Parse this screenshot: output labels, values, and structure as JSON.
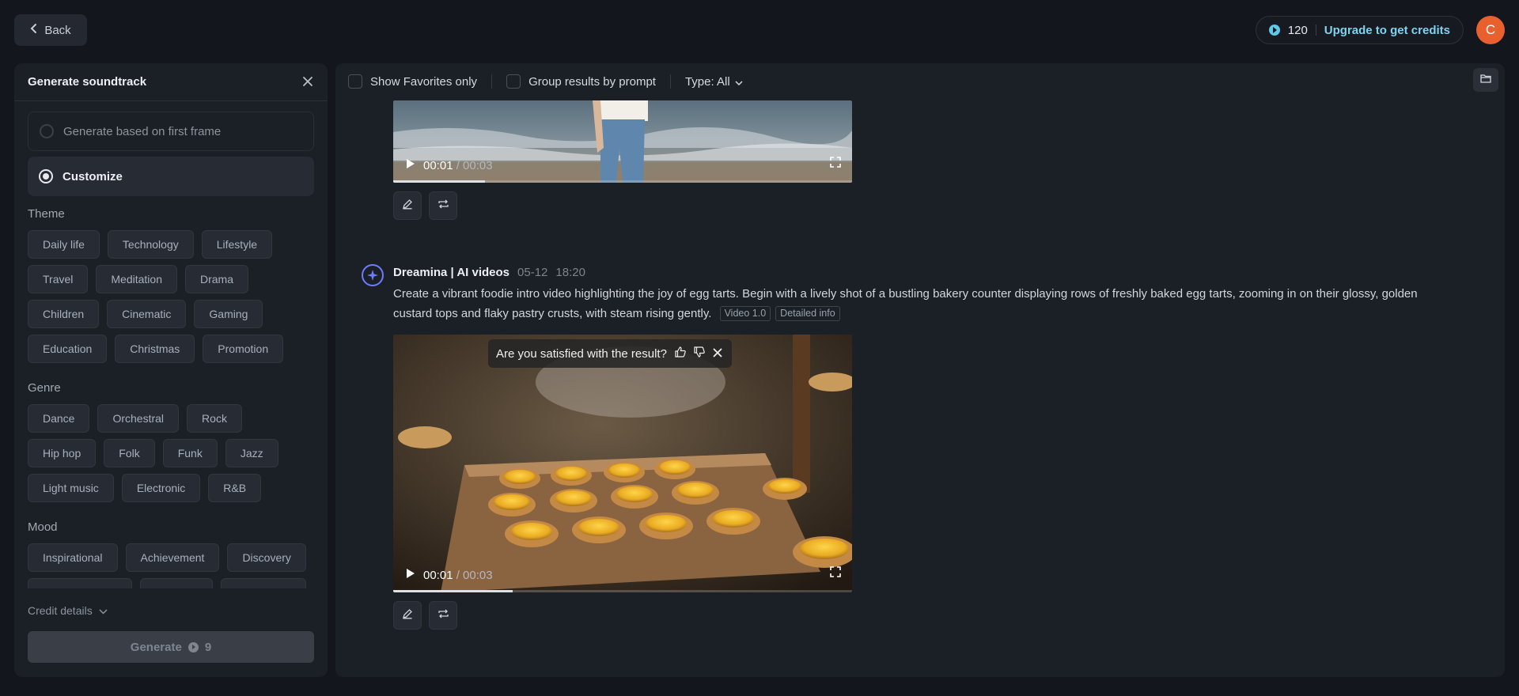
{
  "header": {
    "back_label": "Back",
    "credits": "120",
    "upgrade_label": "Upgrade to get credits",
    "avatar_initial": "C"
  },
  "soundtrack_panel": {
    "title": "Generate soundtrack",
    "options": [
      {
        "label": "Generate based on first frame",
        "selected": false
      },
      {
        "label": "Customize",
        "selected": true
      }
    ],
    "theme": {
      "label": "Theme",
      "chips": [
        "Daily life",
        "Technology",
        "Lifestyle",
        "Travel",
        "Meditation",
        "Drama",
        "Children",
        "Cinematic",
        "Gaming",
        "Education",
        "Christmas",
        "Promotion"
      ]
    },
    "genre": {
      "label": "Genre",
      "chips": [
        "Dance",
        "Orchestral",
        "Rock",
        "Hip hop",
        "Folk",
        "Funk",
        "Jazz",
        "Light music",
        "Electronic",
        "R&B"
      ]
    },
    "mood": {
      "label": "Mood",
      "chips": [
        "Inspirational",
        "Achievement",
        "Discovery"
      ]
    },
    "credit_details_label": "Credit details",
    "generate_label": "Generate",
    "generate_cost": "9"
  },
  "filters": {
    "favorites_label": "Show Favorites only",
    "group_label": "Group results by prompt",
    "type_label": "Type: All"
  },
  "results": [
    {
      "time_current": "00:01",
      "time_total": "/ 00:03",
      "progress": 0.2
    },
    {
      "author": "Dreamina | AI videos",
      "date": "05-12",
      "time": "18:20",
      "prompt": "Create a vibrant foodie intro video highlighting the joy of egg tarts. Begin with a lively shot of a bustling bakery counter displaying rows of freshly baked egg tarts, zooming in on their glossy, golden custard tops and flaky pastry crusts, with steam rising gently.",
      "tags": [
        "Video 1.0",
        "Detailed info"
      ],
      "feedback_question": "Are you satisfied with the result?",
      "time_current": "00:01",
      "time_total": "/ 00:03",
      "progress": 0.26
    }
  ],
  "colors": {
    "background": "#13161c",
    "panel": "#1b1f26",
    "accent": "#7fd3f0",
    "avatar": "#e8602e",
    "brand": "#6d7cff"
  }
}
